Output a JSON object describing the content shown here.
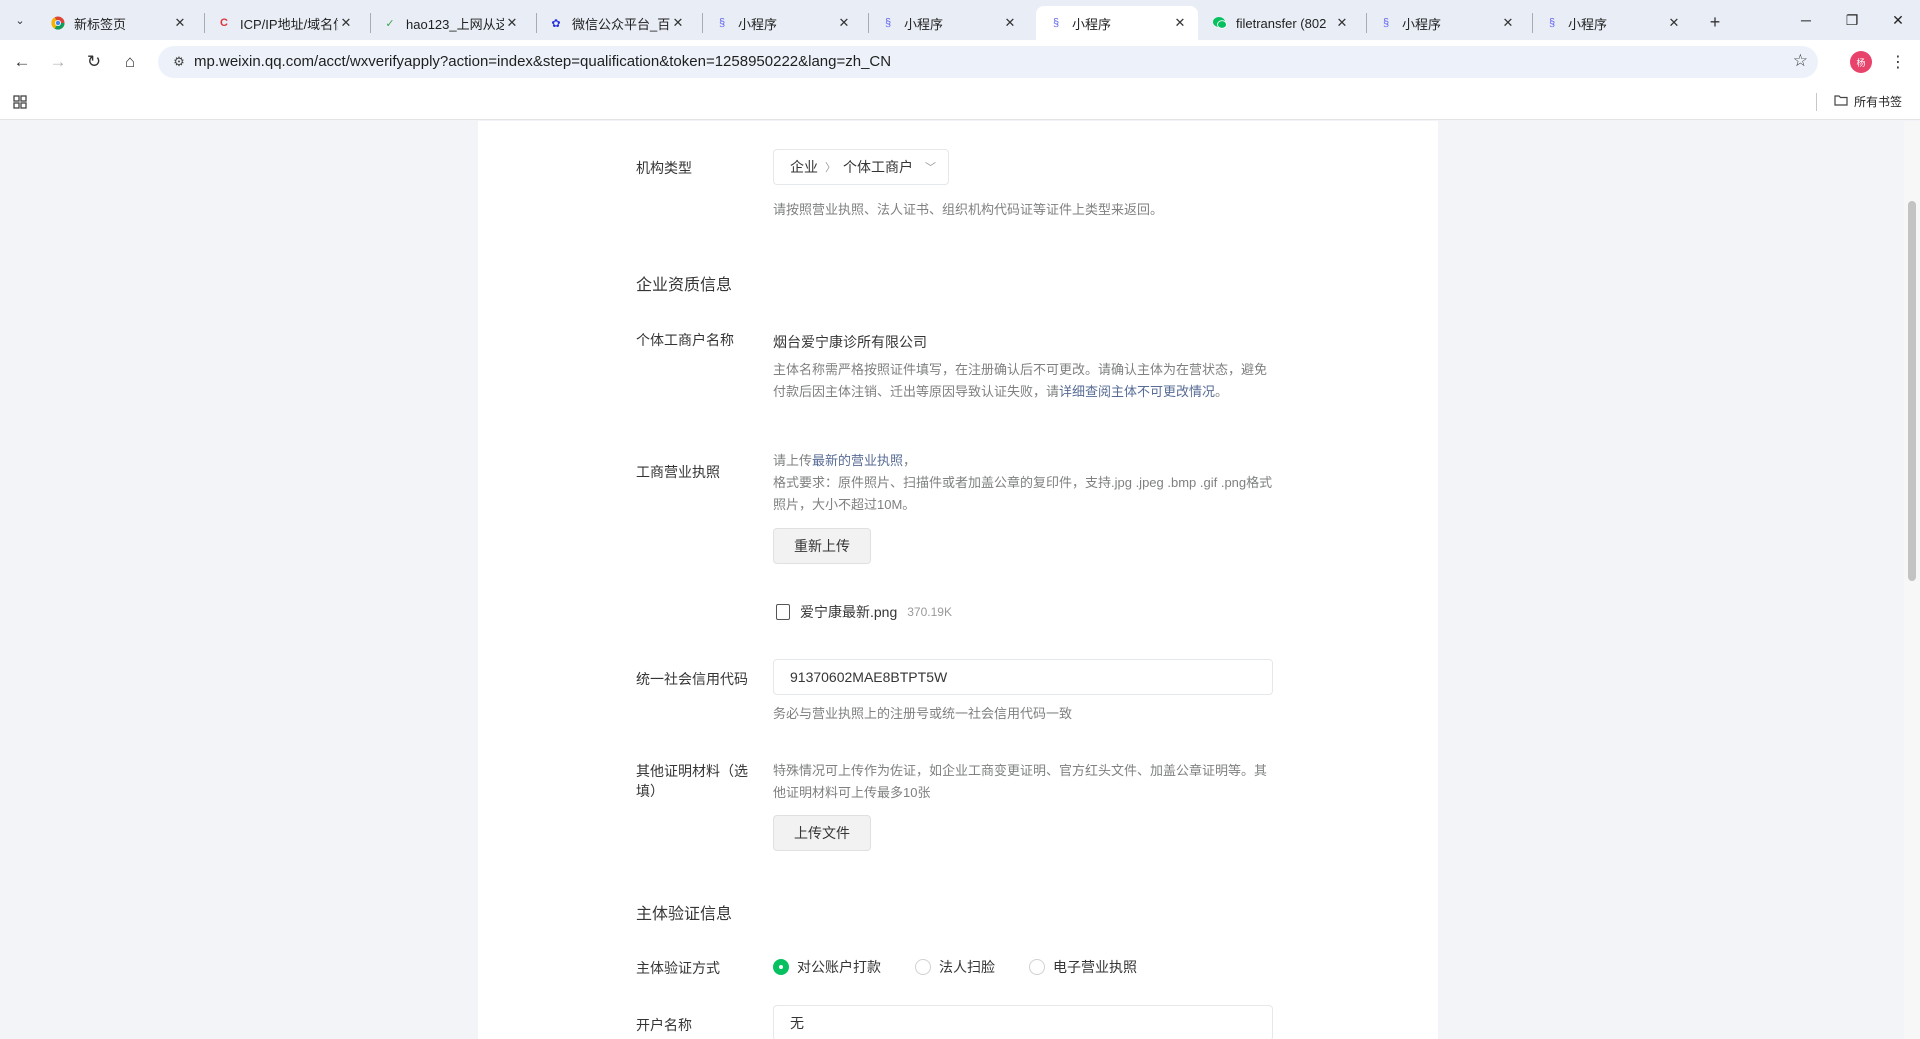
{
  "browser": {
    "tabs": [
      {
        "title": "新标签页",
        "icon": "chrome-icon",
        "active": false
      },
      {
        "title": "ICP/IP地址/域名信",
        "icon": "icp-icon",
        "active": false
      },
      {
        "title": "hao123_上网从这",
        "icon": "hao123-icon",
        "active": false
      },
      {
        "title": "微信公众平台_百",
        "icon": "baidu-paw-icon",
        "active": false
      },
      {
        "title": "小程序",
        "icon": "miniprogram-icon",
        "active": false
      },
      {
        "title": "小程序",
        "icon": "miniprogram-icon",
        "active": false
      },
      {
        "title": "小程序",
        "icon": "miniprogram-icon",
        "active": true
      },
      {
        "title": "filetransfer (802",
        "icon": "wechat-icon",
        "active": false
      },
      {
        "title": "小程序",
        "icon": "miniprogram-icon",
        "active": false
      },
      {
        "title": "小程序",
        "icon": "miniprogram-icon",
        "active": false
      }
    ],
    "url": "mp.weixin.qq.com/acct/wxverifyapply?action=index&step=qualification&token=1258950222&lang=zh_CN",
    "profile_initial": "杨",
    "bookmarks_all": "所有书签"
  },
  "form": {
    "org_type": {
      "label": "机构类型",
      "level1": "企业",
      "level2": "个体工商户",
      "tip": "请按照营业执照、法人证书、组织机构代码证等证件上类型来返回。"
    },
    "qualification_section": "企业资质信息",
    "merchant_name": {
      "label": "个体工商户名称",
      "value": "烟台爱宁康诊所有限公司",
      "tip_prefix": "主体名称需严格按照证件填写，在注册确认后不可更改。请确认主体为在营状态，避免付款后因主体注销、迁出等原因导致认证失败，请",
      "tip_link": "详细查阅主体不可更改情况",
      "tip_suffix": "。"
    },
    "license": {
      "label": "工商营业执照",
      "tip_line1_prefix": "请上传",
      "tip_line1_link": "最新的营业执照",
      "tip_line1_suffix": "，",
      "tip_line2": "格式要求：原件照片、扫描件或者加盖公章的复印件，支持.jpg .jpeg .bmp .gif .png格式照片，大小不超过10M。",
      "reupload_button": "重新上传",
      "file_name": "爱宁康最新.png",
      "file_size": "370.19K"
    },
    "credit_code": {
      "label": "统一社会信用代码",
      "value": "91370602MAE8BTPT5W",
      "tip": "务必与营业执照上的注册号或统一社会信用代码一致"
    },
    "other_materials": {
      "label": "其他证明材料（选填）",
      "tip": "特殊情况可上传作为佐证，如企业工商变更证明、官方红头文件、加盖公章证明等。其他证明材料可上传最多10张",
      "upload_button": "上传文件"
    },
    "verify_section": "主体验证信息",
    "verify_method": {
      "label": "主体验证方式",
      "options": [
        "对公账户打款",
        "法人扫脸",
        "电子营业执照"
      ],
      "selected": "对公账户打款"
    },
    "account_name": {
      "label": "开户名称",
      "value": "无"
    }
  }
}
